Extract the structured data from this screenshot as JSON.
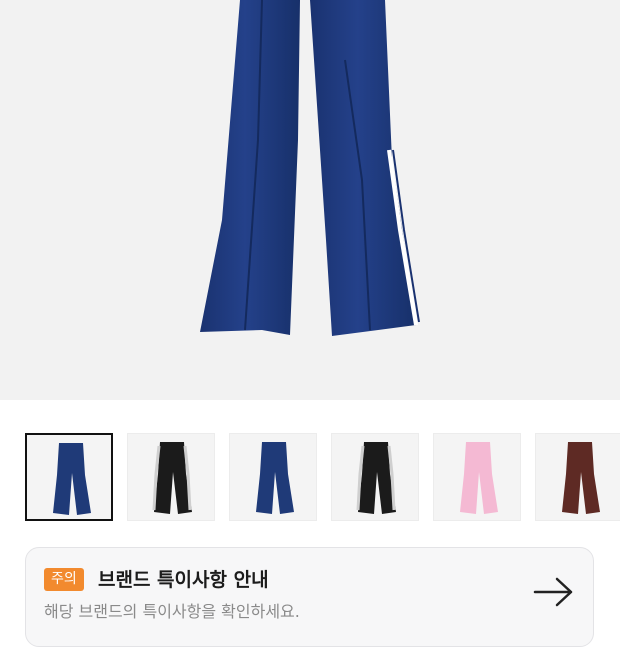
{
  "product": {
    "main_image": "navy-track-pants-image",
    "thumbnails": [
      {
        "icon": "navy-track-pants-thumb",
        "selected": true,
        "color": "#1f3a78",
        "stripe": "#1f3a78"
      },
      {
        "icon": "black-white-track-pants-thumb",
        "selected": false,
        "color": "#1b1b1b",
        "stripe": "#cfcfcf"
      },
      {
        "icon": "navy-track-pants-thumb",
        "selected": false,
        "color": "#1f3a78",
        "stripe": "#1f3a78"
      },
      {
        "icon": "black-white-track-pants-thumb",
        "selected": false,
        "color": "#1b1b1b",
        "stripe": "#cfcfcf"
      },
      {
        "icon": "pink-track-pants-thumb",
        "selected": false,
        "color": "#f4b9d3",
        "stripe": "#f4b9d3"
      },
      {
        "icon": "brown-track-pants-thumb",
        "selected": false,
        "color": "#5e2a24",
        "stripe": "#5e2a24"
      }
    ]
  },
  "notice": {
    "badge": "주의",
    "title": "브랜드 특이사항 안내",
    "description": "해당 브랜드의 특이사항을 확인하세요.",
    "arrow_icon": "arrow-right-icon"
  },
  "colors": {
    "badge": "#f28a2e",
    "navy": "#1f3a78",
    "hero_bg": "#f2f2f2"
  }
}
